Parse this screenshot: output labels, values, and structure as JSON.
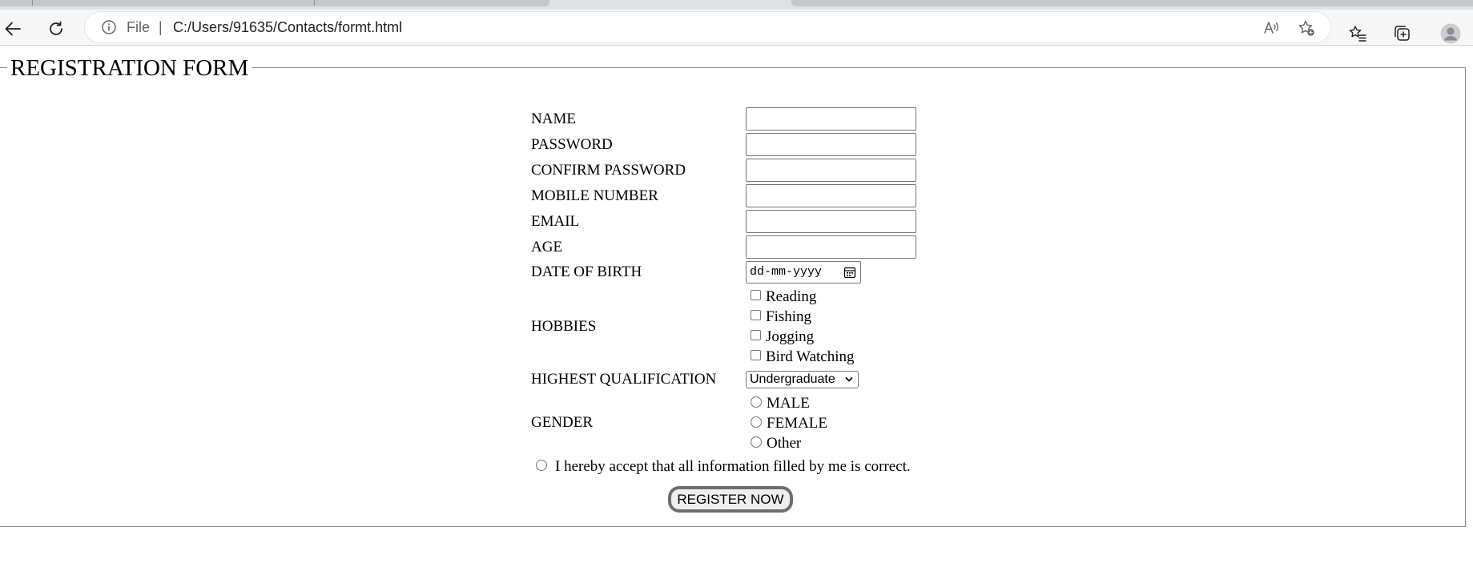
{
  "browser": {
    "address_prefix": "File",
    "address_separator": "|",
    "url": "C:/Users/91635/Contacts/formt.html",
    "icons": {
      "back": "arrow-left-icon",
      "reload": "reload-icon",
      "info": "info-icon",
      "read_aloud": "read-aloud-icon",
      "add_favorite": "star-add-icon",
      "favorites": "favorites-icon",
      "collections": "collections-icon",
      "profile": "profile-icon"
    }
  },
  "form": {
    "legend": "REGISTRATION FORM",
    "fields": {
      "name_label": "NAME",
      "name_value": "",
      "password_label": "PASSWORD",
      "password_value": "",
      "confirm_password_label": "CONFIRM PASSWORD",
      "confirm_password_value": "",
      "mobile_label": "MOBILE NUMBER",
      "mobile_value": "",
      "email_label": "EMAIL",
      "email_value": "",
      "age_label": "AGE",
      "age_value": "",
      "dob_label": "DATE OF BIRTH",
      "dob_placeholder": "dd-mm-yyyy"
    },
    "hobbies": {
      "label": "HOBBIES",
      "options": [
        "Reading",
        "Fishing",
        "Jogging",
        "Bird Watching"
      ],
      "checked": [
        false,
        false,
        false,
        false
      ]
    },
    "qualification": {
      "label": "HIGHEST QUALIFICATION",
      "selected": "Undergraduate"
    },
    "gender": {
      "label": "GENDER",
      "options": [
        "MALE",
        "FEMALE",
        "Other"
      ],
      "selected": null
    },
    "declaration": {
      "text": "I hereby accept that all information filled by me is correct.",
      "checked": false
    },
    "submit_label": "REGISTER NOW"
  },
  "colors": {
    "toolbar_bg": "#f7f7f7",
    "tabstrip_bg": "#dfe1e5",
    "border": "#767676",
    "button_border": "#6e6e6e"
  }
}
